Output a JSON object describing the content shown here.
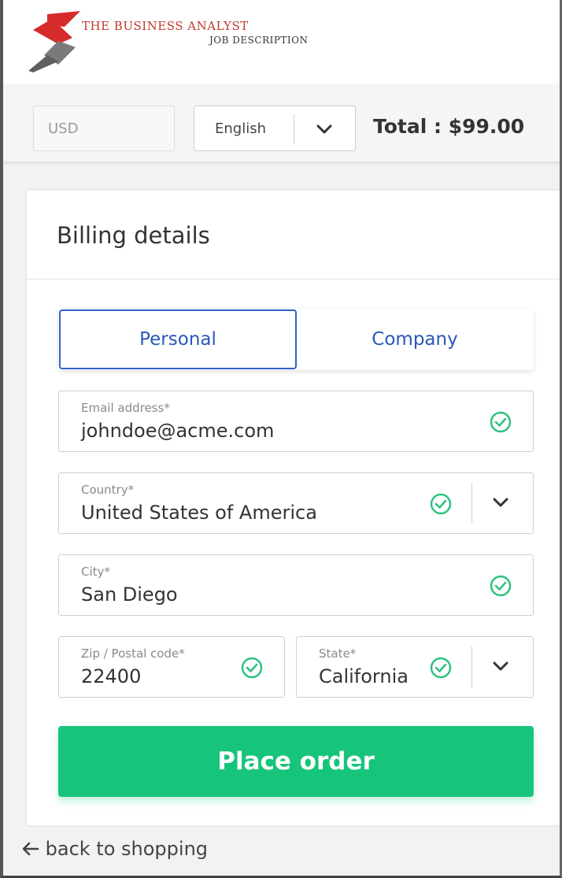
{
  "brand": {
    "title": "THE BUSINESS ANALYST",
    "subtitle": "JOB DESCRIPTION",
    "logo_colors": {
      "red": "#d62b2b",
      "gray": "#6b6b6b"
    }
  },
  "toolbar": {
    "currency_value": "USD",
    "language_selected": "English",
    "total_label": "Total : $99.00"
  },
  "billing": {
    "title": "Billing details",
    "tabs": [
      {
        "label": "Personal",
        "selected": true
      },
      {
        "label": "Company",
        "selected": false
      }
    ],
    "fields": {
      "email": {
        "label": "Email address*",
        "value": "johndoe@acme.com"
      },
      "country": {
        "label": "Country*",
        "value": "United States of America"
      },
      "city": {
        "label": "City*",
        "value": "San Diego"
      },
      "zip": {
        "label": "Zip / Postal code*",
        "value": "22400"
      },
      "state": {
        "label": "State*",
        "value": "California"
      }
    },
    "submit_label": "Place order"
  },
  "footer": {
    "back_label": "back to shopping"
  },
  "icons": {
    "valid": "check-circle-icon",
    "dropdown": "chevron-down-icon",
    "back": "arrow-left-icon"
  },
  "colors": {
    "accent_blue": "#2a57b8",
    "success_green": "#16c57a",
    "valid_check": "#2ec27e"
  }
}
